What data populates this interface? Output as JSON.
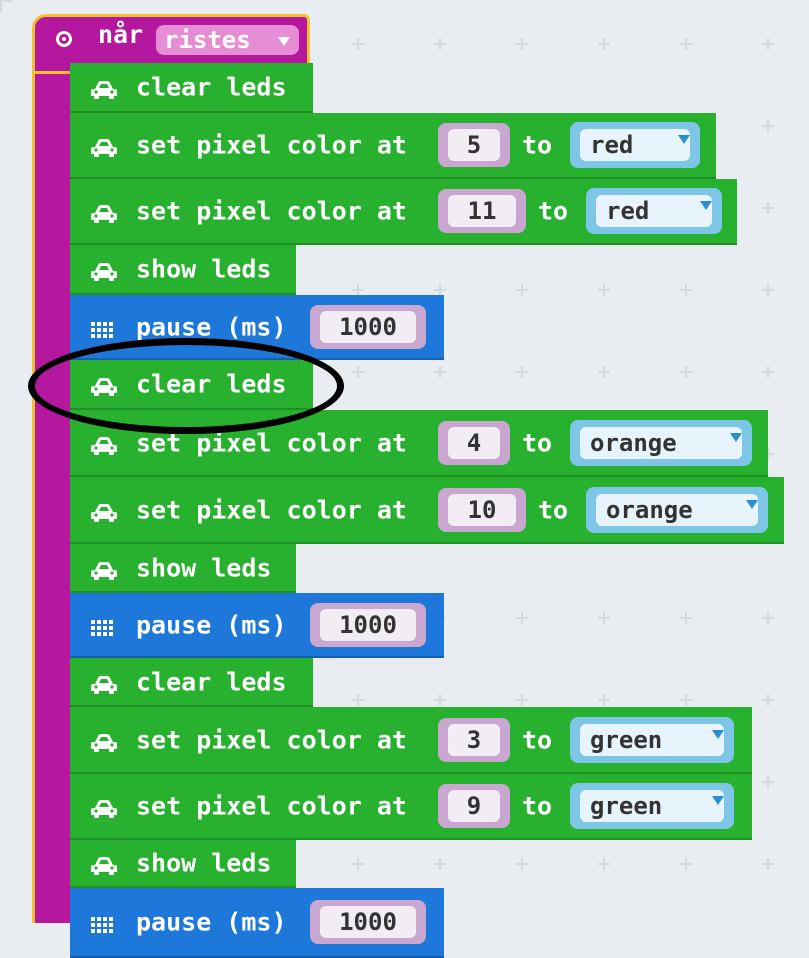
{
  "event": {
    "label": "når",
    "dropdown_value": "ristes"
  },
  "blocks": {
    "b1": {
      "label": "clear leds"
    },
    "b2": {
      "label": "set pixel color at",
      "index": "5",
      "to": "to",
      "color": "red"
    },
    "b3": {
      "label": "set pixel color at",
      "index": "11",
      "to": "to",
      "color": "red"
    },
    "b4": {
      "label": "show leds"
    },
    "b5": {
      "label": "pause (ms)",
      "value": "1000"
    },
    "b6": {
      "label": "clear leds"
    },
    "b7": {
      "label": "set pixel color at",
      "index": "4",
      "to": "to",
      "color": "orange"
    },
    "b8": {
      "label": "set pixel color at",
      "index": "10",
      "to": "to",
      "color": "orange"
    },
    "b9": {
      "label": "show leds"
    },
    "b10": {
      "label": "pause (ms)",
      "value": "1000"
    },
    "b11": {
      "label": "clear leds"
    },
    "b12": {
      "label": "set pixel color at",
      "index": "3",
      "to": "to",
      "color": "green"
    },
    "b13": {
      "label": "set pixel color at",
      "index": "9",
      "to": "to",
      "color": "green"
    },
    "b14": {
      "label": "show leds"
    },
    "b15": {
      "label": "pause (ms)",
      "value": "1000"
    }
  },
  "icons": {
    "light_block": "car-icon",
    "pause_block": "grid-icon",
    "event": "radio-icon"
  },
  "colors": {
    "green": "#27b12e",
    "blue": "#1e78d9",
    "magenta": "#b5189f",
    "highlight": "#000000"
  }
}
